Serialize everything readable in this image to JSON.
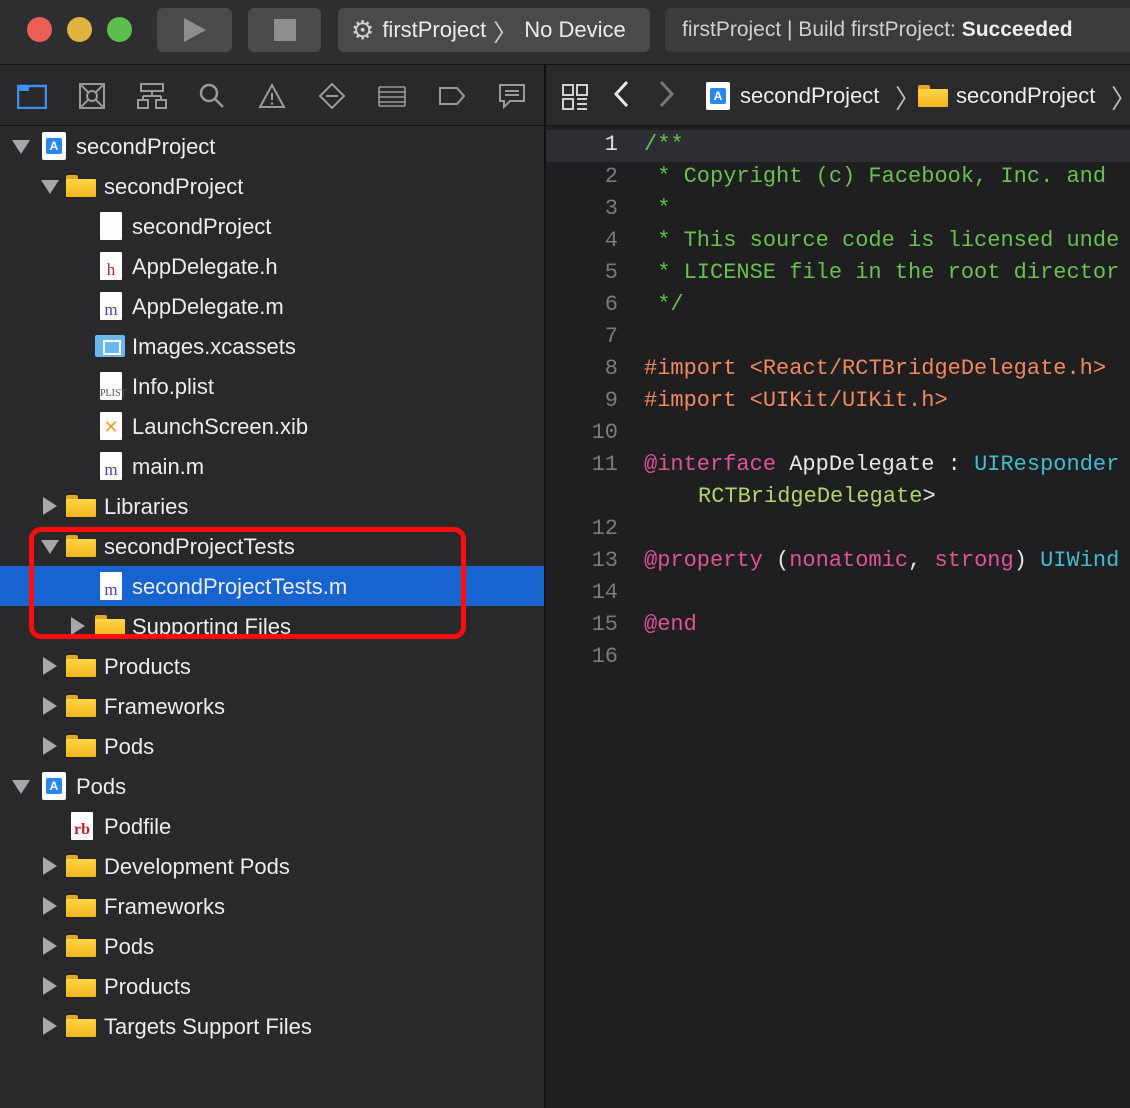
{
  "toolbar": {
    "scheme_project": "firstProject",
    "scheme_device": "No Device",
    "status_prefix": "firstProject | Build firstProject: ",
    "status_result": "Succeeded"
  },
  "navigator": {
    "icons": [
      "folder-icon",
      "source-control-icon",
      "hierarchy-icon",
      "search-icon",
      "warning-icon",
      "test-icon",
      "debug-icon",
      "breakpoint-icon",
      "report-icon"
    ],
    "rows": [
      {
        "label": "secondProject"
      },
      {
        "label": "secondProject"
      },
      {
        "label": "secondProject"
      },
      {
        "label": "AppDelegate.h"
      },
      {
        "label": "AppDelegate.m"
      },
      {
        "label": "Images.xcassets"
      },
      {
        "label": "Info.plist"
      },
      {
        "label": "LaunchScreen.xib"
      },
      {
        "label": "main.m"
      },
      {
        "label": "Libraries"
      },
      {
        "label": "secondProjectTests"
      },
      {
        "label": "secondProjectTests.m"
      },
      {
        "label": "Supporting Files"
      },
      {
        "label": "Products"
      },
      {
        "label": "Frameworks"
      },
      {
        "label": "Pods"
      },
      {
        "label": "Pods"
      },
      {
        "label": "Podfile"
      },
      {
        "label": "Development Pods"
      },
      {
        "label": "Frameworks"
      },
      {
        "label": "Pods"
      },
      {
        "label": "Products"
      },
      {
        "label": "Targets Support Files"
      }
    ],
    "icon_glyphs": {
      "h": "h",
      "m": "m",
      "rb": "rb",
      "plist": "PLIST",
      "xib": "✕"
    }
  },
  "jumpbar": {
    "crumb_project": "secondProject",
    "crumb_folder": "secondProject"
  },
  "editor": {
    "line_numbers": [
      "1",
      "2",
      "3",
      "4",
      "5",
      "6",
      "7",
      "8",
      "9",
      "10",
      "11",
      "",
      "12",
      "13",
      "14",
      "15",
      "16"
    ],
    "lines": {
      "l1": "/**",
      "l2": " * Copyright (c) Facebook, Inc. and",
      "l3": " *",
      "l4": " * This source code is licensed unde",
      "l5": " * LICENSE file in the root director",
      "l6": " */",
      "l8_kw": "#import",
      "l8_str": "<React/RCTBridgeDelegate.h>",
      "l9_kw": "#import",
      "l9_str": "<UIKit/UIKit.h>",
      "l11_kw": "@interface",
      "l11_name": " AppDelegate : ",
      "l11_type": "UIResponder",
      "l11b_proto": "RCTBridgeDelegate",
      "l11b_end": ">",
      "l13_kw": "@property",
      "l13_open": " (",
      "l13_a1": "nonatomic",
      "l13_comma": ", ",
      "l13_a2": "strong",
      "l13_close": ") ",
      "l13_type": "UIWind",
      "l15_kw": "@end"
    }
  }
}
